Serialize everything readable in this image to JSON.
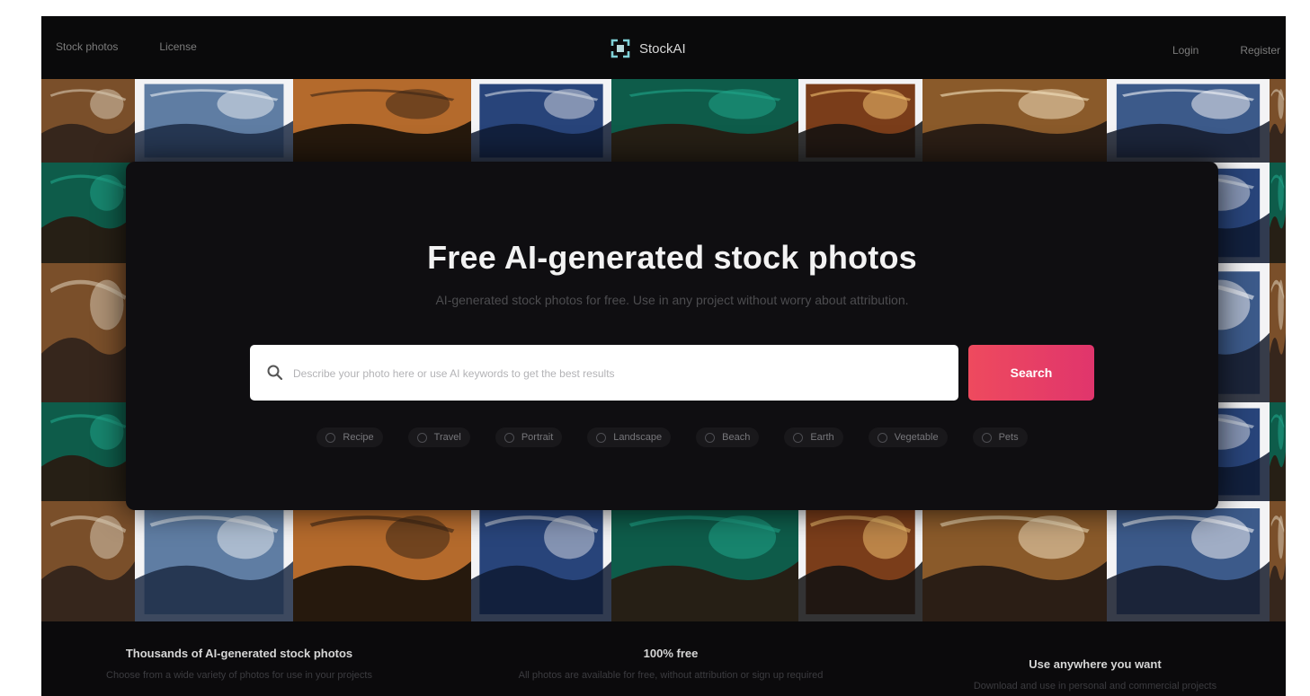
{
  "nav": {
    "left": [
      "Stock photos",
      "License"
    ],
    "brand": "StockAI",
    "right": [
      "Login",
      "Register"
    ]
  },
  "hero": {
    "title": "Free AI-generated stock photos",
    "subtitle": "AI-generated stock photos for free. Use in any project without worry about attribution.",
    "search_placeholder": "Describe your photo here or use AI keywords to get the best results",
    "search_button": "Search",
    "tags": [
      "Recipe",
      "Travel",
      "Portrait",
      "Landscape",
      "Beach",
      "Earth",
      "Vegetable",
      "Pets"
    ]
  },
  "features": [
    {
      "title": "Thousands of AI-generated stock photos",
      "text": "Choose from a wide variety of photos for use in your projects"
    },
    {
      "title": "100% free",
      "text": "All photos are available for free, without attribution or sign up required"
    },
    {
      "title": "Use anywhere you want",
      "text": "Download and use in personal and commercial projects"
    }
  ],
  "colors": {
    "accent_start": "#ee4a5e",
    "accent_end": "#e0356c",
    "background": "#0c0b0d"
  }
}
